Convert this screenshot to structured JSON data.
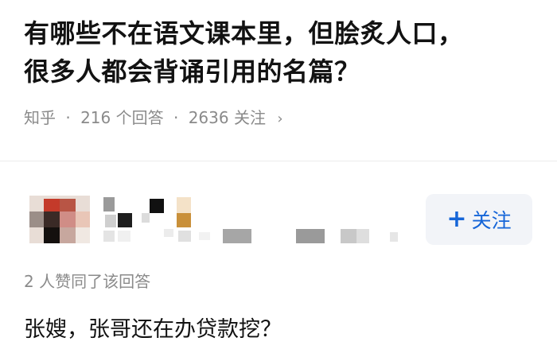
{
  "question": {
    "title_line1": "有哪些不在语文课本里，但脍炙人口，",
    "title_line2": "很多人都会背诵引用的名篇？",
    "source": "知乎",
    "answers_count": "216 个回答",
    "followers_count": "2636 关注",
    "meta_separator": "·",
    "chevron": "›"
  },
  "author": {
    "follow_label": "关注",
    "follow_icon": "plus-icon",
    "follow_color": "#1565d8"
  },
  "answer": {
    "vote_summary": "2 人赞同了该回答",
    "text": "张嫂，张哥还在办贷款挖？"
  }
}
